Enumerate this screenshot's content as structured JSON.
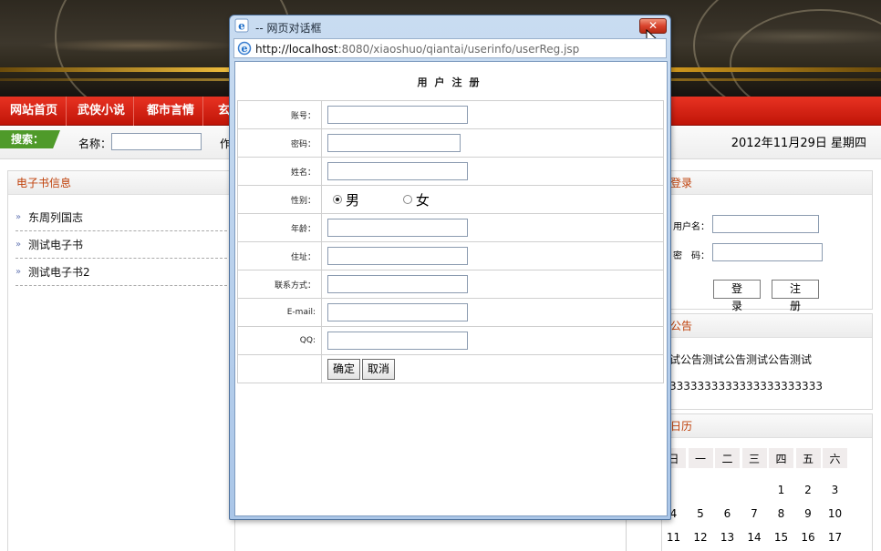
{
  "site": {
    "nav": [
      "网站首页",
      "武侠小说",
      "都市言情",
      "玄"
    ],
    "search": {
      "tag": "搜索：",
      "name_label": "名称：",
      "name_value": "",
      "author_label": "作"
    },
    "date": "2012年11月29日  星期四",
    "ebook_panel": {
      "title": "电子书信息",
      "items": [
        "东周列国志",
        "测试电子书",
        "测试电子书2"
      ]
    },
    "login_panel": {
      "title": "登录",
      "username_label": "用户名：",
      "password_label": "密　码：",
      "login_button": "登 录",
      "register_button": "注 册"
    },
    "notice_panel": {
      "title": "公告",
      "line1": "试公告测试公告测试公告测试",
      "line2": "3333333333333333333333"
    },
    "calendar_panel": {
      "title": "日历",
      "weekdays": [
        "日",
        "一",
        "二",
        "三",
        "四",
        "五",
        "六"
      ],
      "rows": [
        [
          "",
          "",
          "",
          "",
          "1",
          "2",
          "3"
        ],
        [
          "4",
          "5",
          "6",
          "7",
          "8",
          "9",
          "10"
        ],
        [
          "11",
          "12",
          "13",
          "14",
          "15",
          "16",
          "17"
        ]
      ]
    }
  },
  "dialog": {
    "title": "-- 网页对话框",
    "close_symbol": "✕",
    "address_host": "http://localhost",
    "address_rest": ":8080/xiaoshuo/qiantai/userinfo/userReg.jsp",
    "form_title": "用户注册",
    "fields": {
      "account": "账号：",
      "password": "密码：",
      "name": "姓名：",
      "gender": "性别：",
      "age": "年龄：",
      "address": "住址：",
      "contact": "联系方式：",
      "email": "E-mail:",
      "qq": "QQ:"
    },
    "gender_options": {
      "male": "男",
      "female": "女",
      "selected": "男"
    },
    "buttons": {
      "ok": "确定",
      "cancel": "取消"
    }
  }
}
